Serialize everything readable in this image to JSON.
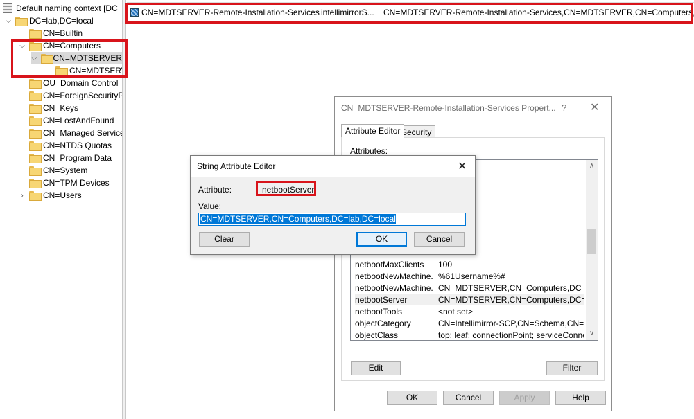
{
  "tree": {
    "items": [
      {
        "label": "Default naming context [DC",
        "icon": "server-icon",
        "twisty": "",
        "indent": 0
      },
      {
        "label": "DC=lab,DC=local",
        "icon": "folder-icon",
        "twisty": "expanded"
      },
      {
        "label": "CN=Builtin",
        "icon": "folder-icon",
        "twisty": ""
      },
      {
        "label": "CN=Computers",
        "icon": "folder-icon",
        "twisty": "expanded"
      },
      {
        "label": "CN=MDTSERVER",
        "icon": "folder-icon",
        "twisty": "expanded",
        "selected": true
      },
      {
        "label": "CN=MDTSERV",
        "icon": "folder-icon",
        "twisty": ""
      },
      {
        "label": "OU=Domain Control",
        "icon": "folder-icon",
        "twisty": ""
      },
      {
        "label": "CN=ForeignSecurityP",
        "icon": "folder-icon",
        "twisty": ""
      },
      {
        "label": "CN=Keys",
        "icon": "folder-icon",
        "twisty": ""
      },
      {
        "label": "CN=LostAndFound",
        "icon": "folder-icon",
        "twisty": ""
      },
      {
        "label": "CN=Managed Service",
        "icon": "folder-icon",
        "twisty": ""
      },
      {
        "label": "CN=NTDS Quotas",
        "icon": "folder-icon",
        "twisty": ""
      },
      {
        "label": "CN=Program Data",
        "icon": "folder-icon",
        "twisty": ""
      },
      {
        "label": "CN=System",
        "icon": "folder-icon",
        "twisty": ""
      },
      {
        "label": "CN=TPM Devices",
        "icon": "folder-icon",
        "twisty": ""
      },
      {
        "label": "CN=Users",
        "icon": "folder-icon",
        "twisty": "collapsed"
      }
    ]
  },
  "list": {
    "row": {
      "name": "CN=MDTSERVER-Remote-Installation-Services",
      "class": "intellimirrorS...",
      "dn": "CN=MDTSERVER-Remote-Installation-Services,CN=MDTSERVER,CN=Computers,..."
    }
  },
  "properties_dialog": {
    "title": "CN=MDTSERVER-Remote-Installation-Services Propert...",
    "help_glyph": "?",
    "close_glyph": "✕",
    "tabs": [
      "Attribute Editor",
      "Security"
    ],
    "attributes_label": "Attributes:",
    "attributes": [
      {
        "name": "netbootMaxClients",
        "value": "100"
      },
      {
        "name": "netbootNewMachine...",
        "value": "%61Username%#"
      },
      {
        "name": "netbootNewMachine...",
        "value": "CN=MDTSERVER,CN=Computers,DC=lab,D"
      },
      {
        "name": "netbootServer",
        "value": "CN=MDTSERVER,CN=Computers,DC=lab,D"
      },
      {
        "name": "netbootTools",
        "value": "<not set>"
      },
      {
        "name": "objectCategory",
        "value": "CN=Intellimirror-SCP,CN=Schema,CN=Config"
      },
      {
        "name": "objectClass",
        "value": "top; leaf; connectionPoint; serviceConnectio"
      }
    ],
    "edit_label": "Edit",
    "filter_label": "Filter",
    "ok_label": "OK",
    "cancel_label": "Cancel",
    "apply_label": "Apply",
    "help_label": "Help"
  },
  "string_editor": {
    "title": "String Attribute Editor",
    "close_glyph": "✕",
    "attribute_label": "Attribute:",
    "attribute_value": "netbootServer",
    "value_label": "Value:",
    "value": "CN=MDTSERVER,CN=Computers,DC=lab,DC=local",
    "clear_label": "Clear",
    "ok_label": "OK",
    "cancel_label": "Cancel"
  },
  "colors": {
    "highlight_box": "#d8141b",
    "selection": "#0078d7"
  }
}
